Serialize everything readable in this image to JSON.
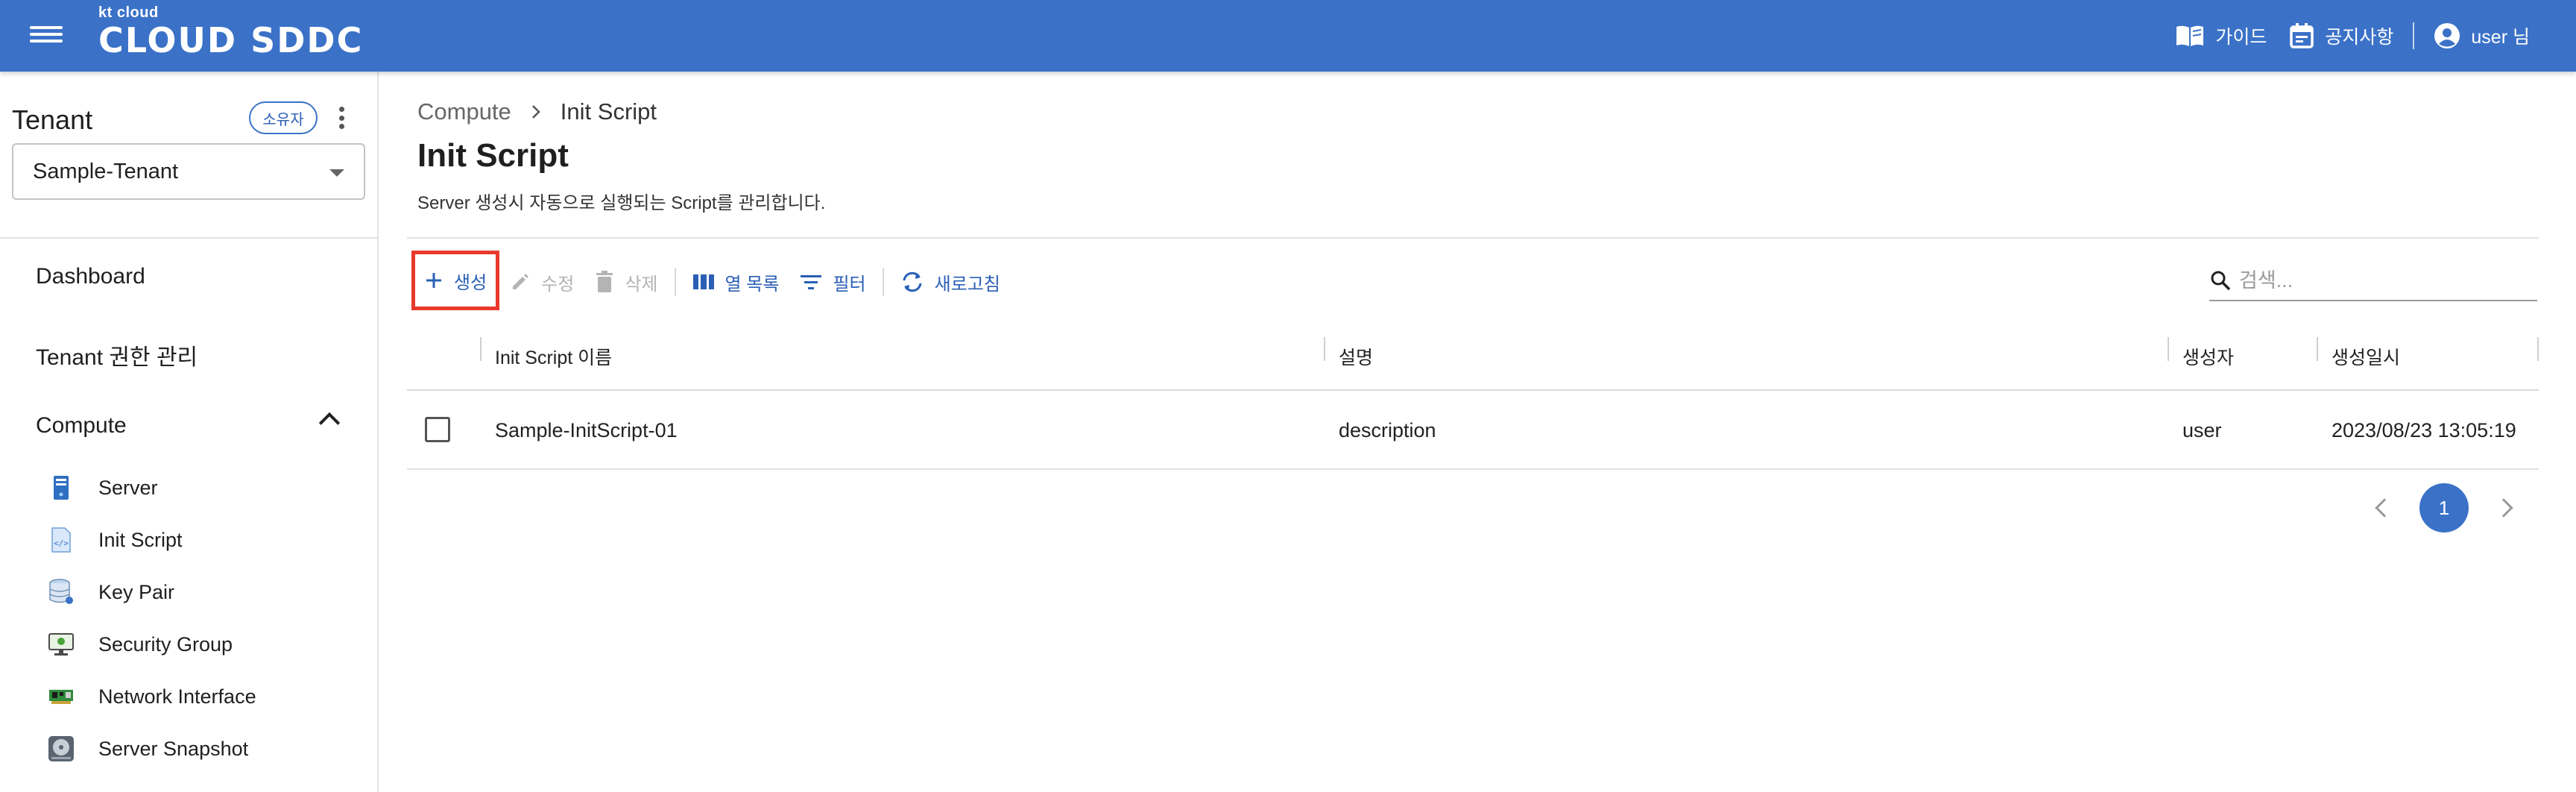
{
  "header": {
    "logo_small": "kt cloud",
    "logo_big": "CLOUD SDDC",
    "guide_label": "가이드",
    "notice_label": "공지사항",
    "user_label": "user 님"
  },
  "sidebar": {
    "tenant_title": "Tenant",
    "owner_badge": "소유자",
    "tenant_selected": "Sample-Tenant",
    "nav": {
      "dashboard": "Dashboard",
      "tenant_perm": "Tenant 권한 관리",
      "compute": "Compute"
    },
    "compute_items": [
      {
        "label": "Server",
        "icon": "server-icon"
      },
      {
        "label": "Init Script",
        "icon": "script-file-icon"
      },
      {
        "label": "Key Pair",
        "icon": "database-key-icon"
      },
      {
        "label": "Security Group",
        "icon": "monitor-icon"
      },
      {
        "label": "Network Interface",
        "icon": "network-card-icon"
      },
      {
        "label": "Server Snapshot",
        "icon": "disk-drive-icon"
      }
    ]
  },
  "breadcrumb": {
    "parent": "Compute",
    "current": "Init Script"
  },
  "page": {
    "title": "Init Script",
    "description": "Server 생성시 자동으로 실행되는 Script를 관리합니다."
  },
  "toolbar": {
    "create_label": "생성",
    "edit_label": "수정",
    "delete_label": "삭제",
    "columns_label": "열 목록",
    "filter_label": "필터",
    "refresh_label": "새로고침"
  },
  "search": {
    "placeholder": "검색..."
  },
  "table": {
    "headers": {
      "name": "Init Script 이름",
      "description": "설명",
      "creator": "생성자",
      "created_at": "생성일시"
    },
    "rows": [
      {
        "name": "Sample-InitScript-01",
        "description": "description",
        "creator": "user",
        "created_at": "2023/08/23 13:05:19"
      }
    ]
  },
  "pagination": {
    "current_page": "1"
  },
  "colors": {
    "brand": "#3b72c8",
    "highlight": "#e8392b",
    "disabled": "#b4b4b4"
  }
}
